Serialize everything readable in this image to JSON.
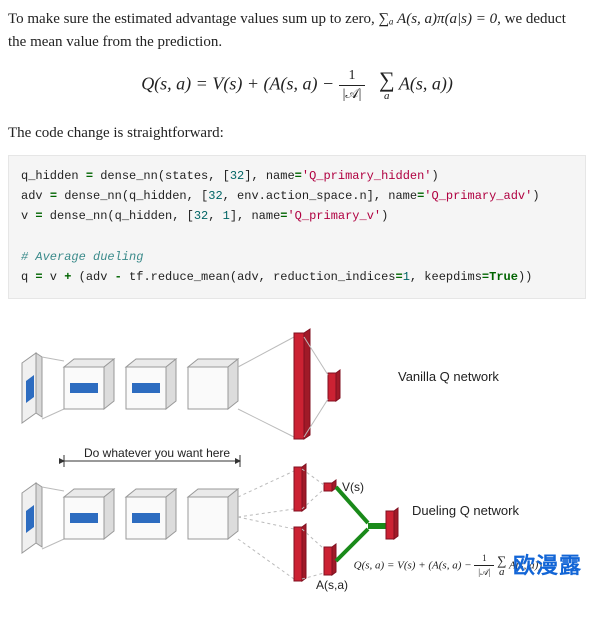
{
  "intro": {
    "line1_prefix": "To make sure the estimated advantage values sum up to zero, ",
    "line1_math": "∑ₐ A(s, a)π(a|s) = 0",
    "line1_suffix": ", we deduct",
    "line2": "the mean value from the prediction."
  },
  "equation": {
    "lhs": "Q(s, a) = V(s) + (A(s, a) − ",
    "frac_num": "1",
    "frac_den": "|𝒜|",
    "sum_sub": "a",
    "rhs_tail": " A(s, a))"
  },
  "code_lead": "The code change is straightforward:",
  "code": {
    "l1_a": "q_hidden ",
    "l1_b": " dense_nn(states, [",
    "l1_n": "32",
    "l1_c": "], name",
    "l1_s": "'Q_primary_hidden'",
    "l1_d": ")",
    "l2_a": "adv ",
    "l2_b": " dense_nn(q_hidden, [",
    "l2_n1": "32",
    "l2_c": ", env.action_space.n], name",
    "l2_s": "'Q_primary_adv'",
    "l2_d": ")",
    "l3_a": "v ",
    "l3_b": " dense_nn(q_hidden, [",
    "l3_n1": "32",
    "l3_c": ", ",
    "l3_n2": "1",
    "l3_d": "], name",
    "l3_s": "'Q_primary_v'",
    "l3_e": ")",
    "l5_cmt": "# Average dueling",
    "l6_a": "q ",
    "l6_b": " v ",
    "l6_c": " (adv ",
    "l6_d": " tf.reduce_mean(adv, reduction_indices",
    "l6_n": "1",
    "l6_e": ", keepdims",
    "l6_kw": "True",
    "l6_f": "))"
  },
  "figure": {
    "label_vanilla": "Vanilla Q network",
    "label_dueling": "Dueling Q network",
    "label_middle": "Do whatever you want here",
    "label_vs": "V(s)",
    "label_as": "A(s,a)",
    "eq_prefix": "Q(s, a) = V(s) + (A(s, a) − ",
    "eq_frac_num": "1",
    "eq_frac_den": "|𝒜|",
    "eq_sum_sub": "a",
    "eq_tail": " A(s, a))"
  },
  "watermark": "欧漫露"
}
